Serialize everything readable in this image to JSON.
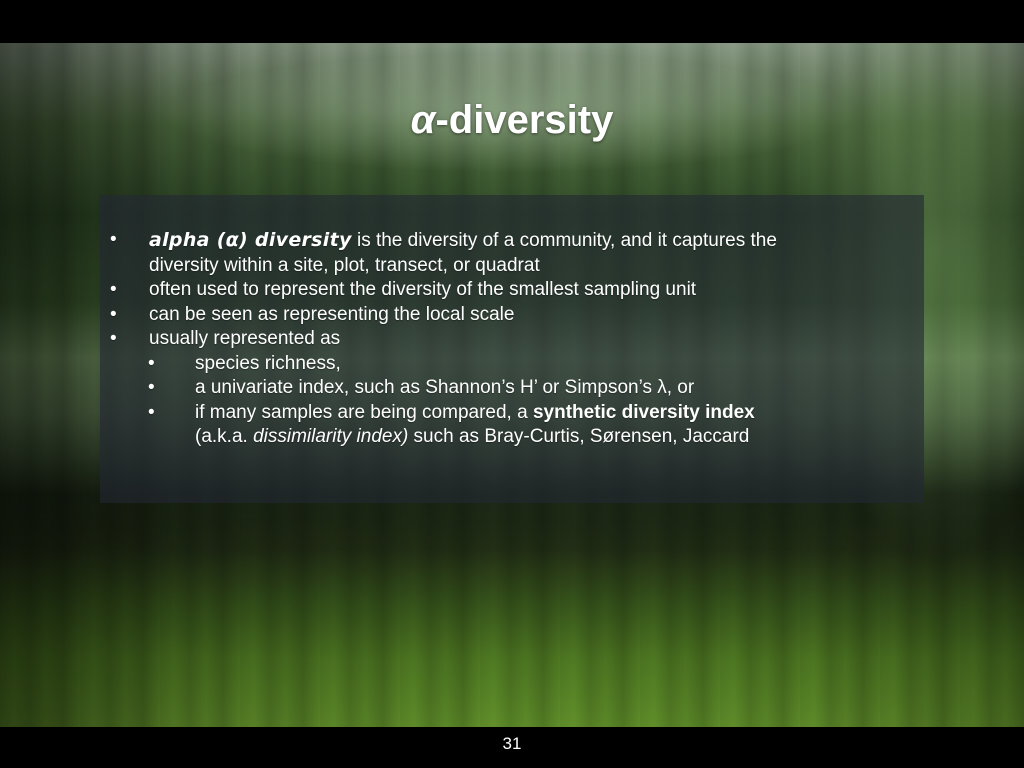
{
  "slide": {
    "title": {
      "alpha": "α",
      "rest": "-diversity"
    },
    "bullets": [
      {
        "term": "alpha (α) diversity",
        "text": " is the diversity of a community, and it captures the",
        "continuation": "diversity within a site, plot, transect, or quadrat"
      },
      {
        "text": "often used to represent the diversity of the smallest sampling unit"
      },
      {
        "text": "can be seen as representing the local scale"
      },
      {
        "text": "usually represented as"
      }
    ],
    "sub_bullets": [
      {
        "text": "species richness,"
      },
      {
        "text": "a univariate index, such as Shannon’s H’ or Simpson’s λ, or"
      },
      {
        "text_before": "if many samples are being compared, a ",
        "bold": "synthetic diversity index",
        "continuation_before": "(a.k.a. ",
        "italic": "dissimilarity index)",
        "continuation_after": " such as Bray-Curtis, Sørensen, Jaccard"
      }
    ],
    "bullet_char": "•",
    "page_number": "31"
  },
  "colors": {
    "text": "#ffffff",
    "letterbox": "#000000",
    "content_box": "#23283499"
  }
}
